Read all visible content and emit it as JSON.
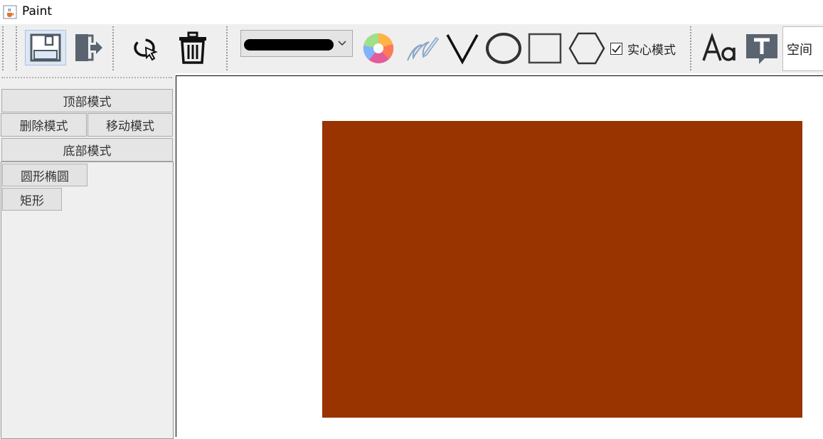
{
  "window": {
    "title": "Paint",
    "app_icon": "java-cup-icon"
  },
  "toolbar": {
    "tools": [
      {
        "name": "save",
        "icon": "floppy-disk-icon",
        "selected": true
      },
      {
        "name": "exit",
        "icon": "exit-door-icon"
      },
      {
        "name": "select",
        "icon": "lasso-cursor-icon"
      },
      {
        "name": "delete",
        "icon": "trash-can-icon"
      },
      {
        "name": "color",
        "icon": "color-wheel-icon"
      },
      {
        "name": "pen",
        "icon": "pen-scribble-icon"
      },
      {
        "name": "line",
        "icon": "v-line-icon"
      },
      {
        "name": "ellipse",
        "icon": "ellipse-outline-icon"
      },
      {
        "name": "rectangle",
        "icon": "rectangle-outline-icon"
      },
      {
        "name": "polygon",
        "icon": "hexagon-outline-icon"
      },
      {
        "name": "font",
        "icon": "font-aa-icon"
      },
      {
        "name": "text",
        "icon": "text-bubble-icon"
      }
    ],
    "stroke_select": {
      "selected": "thick-line"
    },
    "solid_mode": {
      "label": "实心模式",
      "checked": true
    },
    "space_field": {
      "value": "空间"
    }
  },
  "left_panel": {
    "top_mode": "顶部模式",
    "delete_mode": "删除模式",
    "move_mode": "移动模式",
    "bottom_mode": "底部模式",
    "shapes": [
      "圆形椭圆",
      "矩形"
    ]
  },
  "canvas": {
    "background": "#ffffff",
    "shape": {
      "type": "rectangle",
      "fill": "#993300"
    }
  },
  "colors": {
    "toolbar_bg": "#efefef",
    "selection_bg": "#dbe7f4",
    "accent_icon": "#5a6470"
  }
}
